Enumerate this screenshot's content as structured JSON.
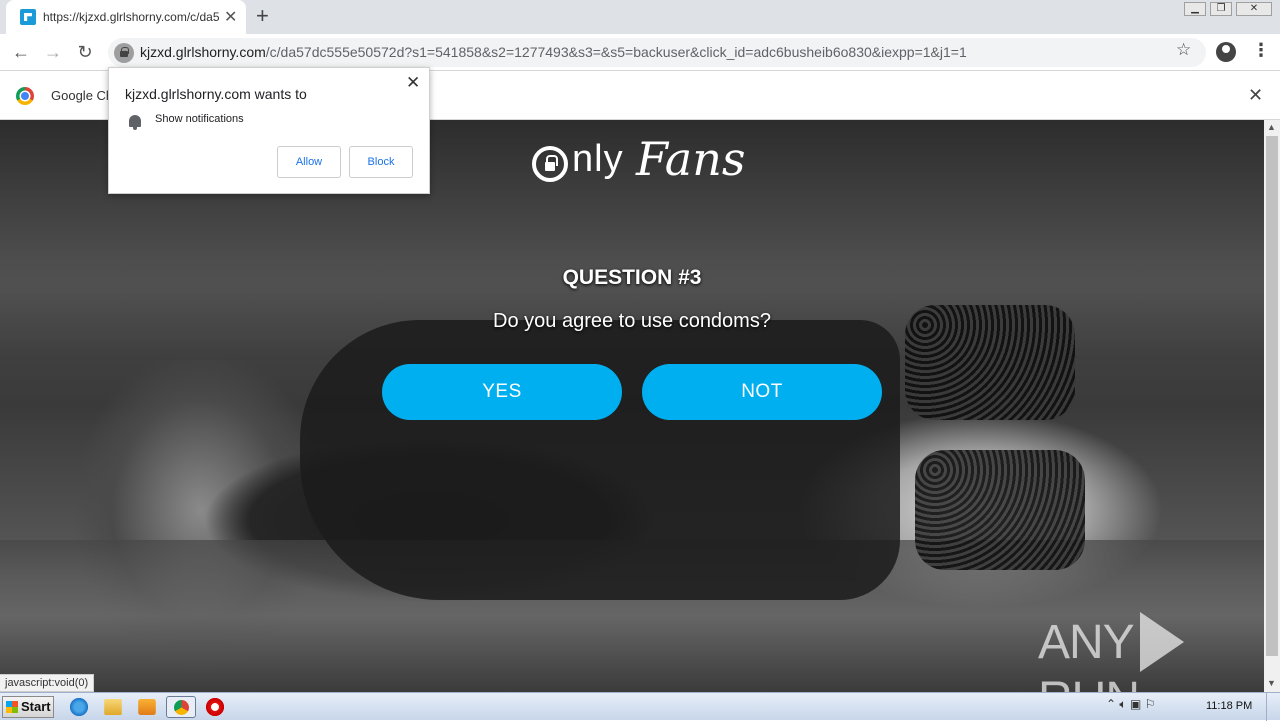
{
  "tab": {
    "title": "https://kjzxd.glrlshorny.com/c/da57"
  },
  "toolbar": {
    "url_host": "kjzxd.glrlshorny.com",
    "url_path": "/c/da57dc555e50572d?s1=541858&s2=1277493&s3=&s5=backuser&click_id=adc6busheib6o830&iexpp=1&j1=1"
  },
  "infobar": {
    "text": "Google Ch"
  },
  "permission_popup": {
    "title": "kjzxd.glrlshorny.com wants to",
    "permission": "Show notifications",
    "allow_label": "Allow",
    "block_label": "Block"
  },
  "page": {
    "logo_prefix": "nly",
    "logo_suffix": "Fans",
    "question_title": "QUESTION #3",
    "question_text": "Do you agree to use condoms?",
    "yes_label": "YES",
    "no_label": "NOT",
    "watermark_left": "ANY",
    "watermark_right": "RUN"
  },
  "status_bar": {
    "text": "javascript:void(0)"
  },
  "taskbar": {
    "start_label": "Start",
    "clock": "11:18 PM"
  },
  "colors": {
    "accent_button": "#00aff0",
    "tab_strip": "#dee1e6"
  }
}
